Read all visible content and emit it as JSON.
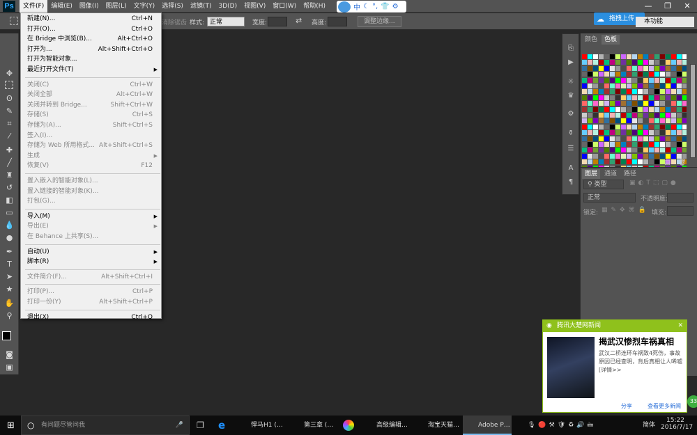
{
  "app": {
    "logo": "Ps",
    "menus": [
      "文件(F)",
      "编辑(E)",
      "图像(I)",
      "图层(L)",
      "文字(Y)",
      "选择(S)",
      "滤镜(T)",
      "3D(D)",
      "视图(V)",
      "窗口(W)",
      "帮助(H)"
    ],
    "window_controls": [
      "—",
      "❐",
      "✕"
    ]
  },
  "ime": {
    "items": [
      "中",
      "☾",
      "°,",
      "👕",
      "⚙"
    ]
  },
  "options": {
    "style_label": "样式:",
    "style_value": "正常",
    "width_label": "宽度:",
    "height_label": "高度:",
    "refine_button": "调整边缘...",
    "feather_fragment": "消除锯齿",
    "upload_button": "拖拽上传",
    "workspace_value": "本功能"
  },
  "file_menu": {
    "items": [
      {
        "label": "新建(N)...",
        "shortcut": "Ctrl+N",
        "disabled": false,
        "arrow": false
      },
      {
        "label": "打开(O)...",
        "shortcut": "Ctrl+O",
        "disabled": false,
        "arrow": false
      },
      {
        "label": "在 Bridge 中浏览(B)...",
        "shortcut": "Alt+Ctrl+O",
        "disabled": false,
        "arrow": false
      },
      {
        "label": "打开为...",
        "shortcut": "Alt+Shift+Ctrl+O",
        "disabled": false,
        "arrow": false
      },
      {
        "label": "打开为智能对象...",
        "shortcut": "",
        "disabled": false,
        "arrow": false
      },
      {
        "label": "最近打开文件(T)",
        "shortcut": "",
        "disabled": false,
        "arrow": true
      },
      {
        "sep": true
      },
      {
        "label": "关闭(C)",
        "shortcut": "Ctrl+W",
        "disabled": true,
        "arrow": false
      },
      {
        "label": "关闭全部",
        "shortcut": "Alt+Ctrl+W",
        "disabled": true,
        "arrow": false
      },
      {
        "label": "关闭并转到 Bridge...",
        "shortcut": "Shift+Ctrl+W",
        "disabled": true,
        "arrow": false
      },
      {
        "label": "存储(S)",
        "shortcut": "Ctrl+S",
        "disabled": true,
        "arrow": false
      },
      {
        "label": "存储为(A)...",
        "shortcut": "Shift+Ctrl+S",
        "disabled": true,
        "arrow": false
      },
      {
        "label": "签入(I)...",
        "shortcut": "",
        "disabled": true,
        "arrow": false
      },
      {
        "label": "存储为 Web 所用格式...",
        "shortcut": "Alt+Shift+Ctrl+S",
        "disabled": true,
        "arrow": false
      },
      {
        "label": "生成",
        "shortcut": "",
        "disabled": true,
        "arrow": true
      },
      {
        "label": "恢复(V)",
        "shortcut": "F12",
        "disabled": true,
        "arrow": false
      },
      {
        "sep": true
      },
      {
        "label": "置入嵌入的智能对象(L)...",
        "shortcut": "",
        "disabled": true,
        "arrow": false
      },
      {
        "label": "置入链接的智能对象(K)...",
        "shortcut": "",
        "disabled": true,
        "arrow": false
      },
      {
        "label": "打包(G)...",
        "shortcut": "",
        "disabled": true,
        "arrow": false
      },
      {
        "sep": true
      },
      {
        "label": "导入(M)",
        "shortcut": "",
        "disabled": false,
        "arrow": true
      },
      {
        "label": "导出(E)",
        "shortcut": "",
        "disabled": true,
        "arrow": true
      },
      {
        "label": "在 Behance 上共享(S)...",
        "shortcut": "",
        "disabled": true,
        "arrow": false
      },
      {
        "sep": true
      },
      {
        "label": "自动(U)",
        "shortcut": "",
        "disabled": false,
        "arrow": true
      },
      {
        "label": "脚本(R)",
        "shortcut": "",
        "disabled": false,
        "arrow": true
      },
      {
        "sep": true
      },
      {
        "label": "文件简介(F)...",
        "shortcut": "Alt+Shift+Ctrl+I",
        "disabled": true,
        "arrow": false
      },
      {
        "sep": true
      },
      {
        "label": "打印(P)...",
        "shortcut": "Ctrl+P",
        "disabled": true,
        "arrow": false
      },
      {
        "label": "打印一份(Y)",
        "shortcut": "Alt+Shift+Ctrl+P",
        "disabled": true,
        "arrow": false
      },
      {
        "sep": true
      },
      {
        "label": "退出(X)",
        "shortcut": "Ctrl+Q",
        "disabled": false,
        "arrow": false
      }
    ]
  },
  "swatches": {
    "tabs": [
      "颜色",
      "色板"
    ],
    "colors": [
      "#ff0000",
      "#ffff00",
      "#00ff00",
      "#00ffff",
      "#0000ff",
      "#ff00ff",
      "#ffffff",
      "#e6e6e6",
      "#cccccc",
      "#b3b3b3",
      "#999999",
      "#808080",
      "#666666",
      "#4d4d4d",
      "#333333",
      "#000000",
      "#ff6666",
      "#ffcc66",
      "#ccff66",
      "#66ffcc",
      "#66ccff",
      "#cc66ff",
      "#ff66cc",
      "#f2b3b3",
      "#f2dab3",
      "#e0f2b3",
      "#b3f2e0",
      "#b3d5f2",
      "#d1b3f2",
      "#c00000",
      "#c08000",
      "#80c000",
      "#00c080",
      "#0080c0",
      "#8000c0",
      "#c00080",
      "#a03030",
      "#a07030",
      "#70a030",
      "#30a070",
      "#3070a0",
      "#7030a0",
      "#800000",
      "#805000",
      "#508000",
      "#008050",
      "#005080",
      "#500080"
    ]
  },
  "layers": {
    "tabs": [
      "图层",
      "通道",
      "路径"
    ],
    "kind_label": "类型",
    "blend_mode": "正常",
    "opacity_label": "不透明度:",
    "lock_label": "锁定:",
    "fill_label": "填充:"
  },
  "news": {
    "source": "腾讯大楚网新闻",
    "title": "揭武汉惨烈车祸真相",
    "body": "武汉二桥连环车祸致4死伤，事故原因已经查明，背后真相让人唏嘘 [详情>>",
    "share": "分享",
    "more": "查看更多新闻"
  },
  "taskbar": {
    "search_placeholder": "有问题尽管问我",
    "apps": [
      "悍马H1 (…",
      "第三章 (…",
      "高级编辑…",
      "淘宝天猫…",
      "Adobe P…"
    ],
    "time": "15:22",
    "date": "2016/7/17",
    "ime": "简体",
    "badge": "33"
  }
}
